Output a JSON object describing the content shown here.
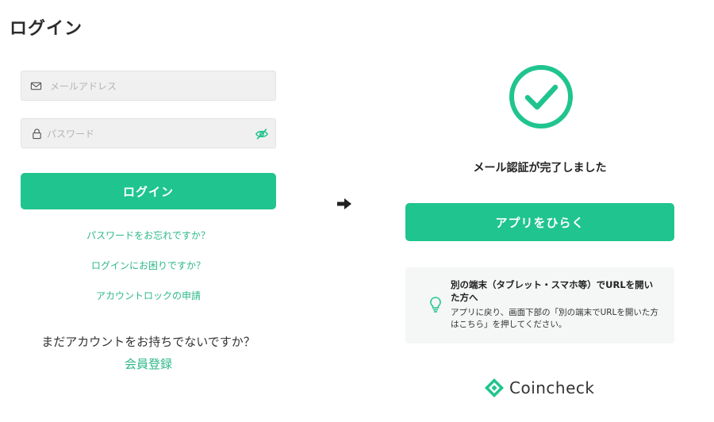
{
  "login": {
    "title": "ログイン",
    "email_placeholder": "メールアドレス",
    "password_placeholder": "パスワード",
    "login_button": "ログイン",
    "forgot_password": "パスワードをお忘れですか？",
    "trouble_login": "ログインにお困りですか？",
    "account_lock": "アカウントロックの申請",
    "no_account": "まだアカウントをお持ちでないですか？",
    "register": "会員登録"
  },
  "confirmation": {
    "verified_text": "メール認証が完了しました",
    "open_app_button": "アプリをひらく",
    "info_title": "別の端末（タブレット・スマホ等）でURLを開いた方へ",
    "info_body": "アプリに戻り、画面下部の「別の端末でURLを開いた方はこちら」を押してください。",
    "brand_name": "Coincheck"
  },
  "icons": {
    "email": "mail-icon",
    "password": "lock-icon",
    "visibility": "eye-off-icon",
    "flow_arrow": "right-arrow-icon",
    "success": "check-circle-icon",
    "tip": "lightbulb-icon",
    "logo": "coincheck-logo-icon"
  },
  "colors": {
    "brand_green": "#20c48f",
    "link_green": "#2db889",
    "field_bg": "#f0f0f0",
    "info_bg": "#f5f6f6"
  }
}
